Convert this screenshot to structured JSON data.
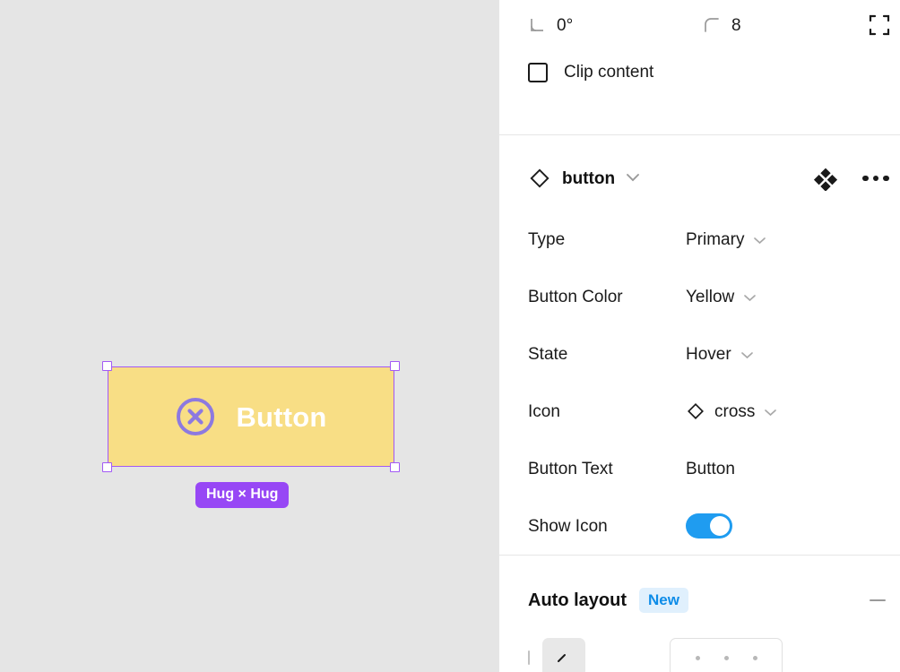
{
  "canvas": {
    "background_color": "#e5e5e5",
    "component": {
      "label": "Button",
      "fill_color": "#f8de85",
      "text_color": "#ffffff",
      "icon_name": "cross-circle-icon",
      "icon_color": "#8d79e0"
    },
    "selection": {
      "stroke_color": "#a259f5",
      "handle_fill": "#ffffff"
    },
    "size_badge": {
      "text": "Hug × Hug",
      "background_color": "#9747f5",
      "text_color": "#ffffff"
    }
  },
  "panel": {
    "transform": {
      "rotation": {
        "icon": "angle-icon",
        "value": "0°"
      },
      "corner_radius": {
        "icon": "corner-radius-icon",
        "value": "8"
      },
      "independent_corners_icon": "independent-corners-icon",
      "clip_content": {
        "label": "Clip content",
        "checked": false
      }
    },
    "component": {
      "icon": "component-diamond-icon",
      "name": "button",
      "chevron": "⌄",
      "swap_icon": "swap-instance-icon",
      "more_icon": "more-options-icon",
      "properties": [
        {
          "label": "Type",
          "value": "Primary",
          "kind": "select"
        },
        {
          "label": "Button Color",
          "value": "Yellow",
          "kind": "select"
        },
        {
          "label": "State",
          "value": "Hover",
          "kind": "select"
        },
        {
          "label": "Icon",
          "value": "cross",
          "kind": "instance-swap",
          "icon": "component-diamond-icon"
        },
        {
          "label": "Button Text",
          "value": "Button",
          "kind": "text"
        },
        {
          "label": "Show Icon",
          "value": "on",
          "kind": "boolean"
        }
      ]
    },
    "auto_layout": {
      "title": "Auto layout",
      "badge": "New",
      "badge_color": "#0d8ce8",
      "badge_bg": "#e0f0fd",
      "collapse_icon": "minus-icon",
      "direction_icon": "layout-direction-icon",
      "alignment_icon": "alignment-grid-icon"
    }
  }
}
